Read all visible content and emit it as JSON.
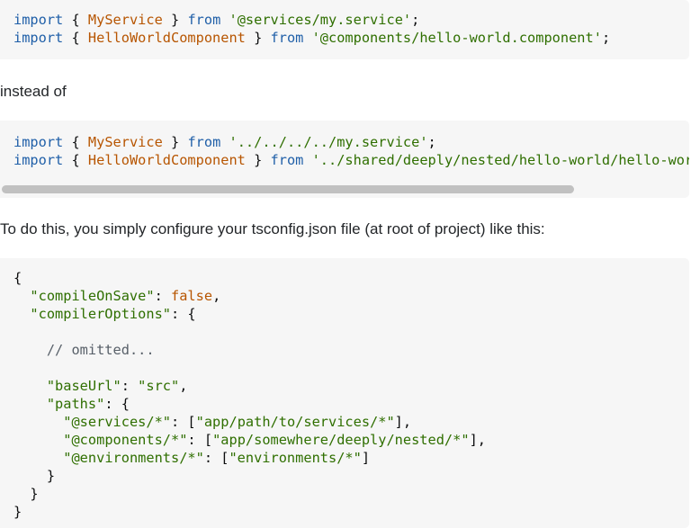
{
  "block1": {
    "lines": [
      [
        [
          "kw2",
          "import"
        ],
        [
          "pun",
          " { "
        ],
        [
          "cls",
          "MyService"
        ],
        [
          "pun",
          " } "
        ],
        [
          "kw2",
          "from"
        ],
        [
          "pun",
          " "
        ],
        [
          "str",
          "'@services/my.service'"
        ],
        [
          "pun",
          ";"
        ]
      ],
      [
        [
          "kw2",
          "import"
        ],
        [
          "pun",
          " { "
        ],
        [
          "cls",
          "HelloWorldComponent"
        ],
        [
          "pun",
          " } "
        ],
        [
          "kw2",
          "from"
        ],
        [
          "pun",
          " "
        ],
        [
          "str",
          "'@components/hello-world.component'"
        ],
        [
          "pun",
          ";"
        ]
      ]
    ]
  },
  "text1": "instead of",
  "block2": {
    "lines": [
      [
        [
          "kw2",
          "import"
        ],
        [
          "pun",
          " { "
        ],
        [
          "cls",
          "MyService"
        ],
        [
          "pun",
          " } "
        ],
        [
          "kw2",
          "from"
        ],
        [
          "pun",
          " "
        ],
        [
          "str",
          "'../../../../my.service'"
        ],
        [
          "pun",
          ";"
        ]
      ],
      [
        [
          "kw2",
          "import"
        ],
        [
          "pun",
          " { "
        ],
        [
          "cls",
          "HelloWorldComponent"
        ],
        [
          "pun",
          " } "
        ],
        [
          "kw2",
          "from"
        ],
        [
          "pun",
          " "
        ],
        [
          "str",
          "'../shared/deeply/nested/hello-world/hello-world.component'"
        ],
        [
          "pun",
          ";"
        ]
      ]
    ]
  },
  "text2": "To do this, you simply configure your tsconfig.json file (at root of project) like this:",
  "block3": {
    "lines": [
      [
        [
          "pun",
          "{"
        ]
      ],
      [
        [
          "pun",
          "  "
        ],
        [
          "prop",
          "\"compileOnSave\""
        ],
        [
          "pun",
          ": "
        ],
        [
          "bool",
          "false"
        ],
        [
          "pun",
          ","
        ]
      ],
      [
        [
          "pun",
          "  "
        ],
        [
          "prop",
          "\"compilerOptions\""
        ],
        [
          "pun",
          ": {"
        ]
      ],
      [
        [
          "pun",
          ""
        ]
      ],
      [
        [
          "pun",
          "    "
        ],
        [
          "cmt",
          "// omitted..."
        ]
      ],
      [
        [
          "pun",
          ""
        ]
      ],
      [
        [
          "pun",
          "    "
        ],
        [
          "prop",
          "\"baseUrl\""
        ],
        [
          "pun",
          ": "
        ],
        [
          "str",
          "\"src\""
        ],
        [
          "pun",
          ","
        ]
      ],
      [
        [
          "pun",
          "    "
        ],
        [
          "prop",
          "\"paths\""
        ],
        [
          "pun",
          ": {"
        ]
      ],
      [
        [
          "pun",
          "      "
        ],
        [
          "prop",
          "\"@services/*\""
        ],
        [
          "pun",
          ": ["
        ],
        [
          "str",
          "\"app/path/to/services/*\""
        ],
        [
          "pun",
          "],"
        ]
      ],
      [
        [
          "pun",
          "      "
        ],
        [
          "prop",
          "\"@components/*\""
        ],
        [
          "pun",
          ": ["
        ],
        [
          "str",
          "\"app/somewhere/deeply/nested/*\""
        ],
        [
          "pun",
          "],"
        ]
      ],
      [
        [
          "pun",
          "      "
        ],
        [
          "prop",
          "\"@environments/*\""
        ],
        [
          "pun",
          ": ["
        ],
        [
          "str",
          "\"environments/*\""
        ],
        [
          "pun",
          "]"
        ]
      ],
      [
        [
          "pun",
          "    }"
        ]
      ],
      [
        [
          "pun",
          "  }"
        ]
      ],
      [
        [
          "pun",
          "}"
        ]
      ]
    ]
  }
}
